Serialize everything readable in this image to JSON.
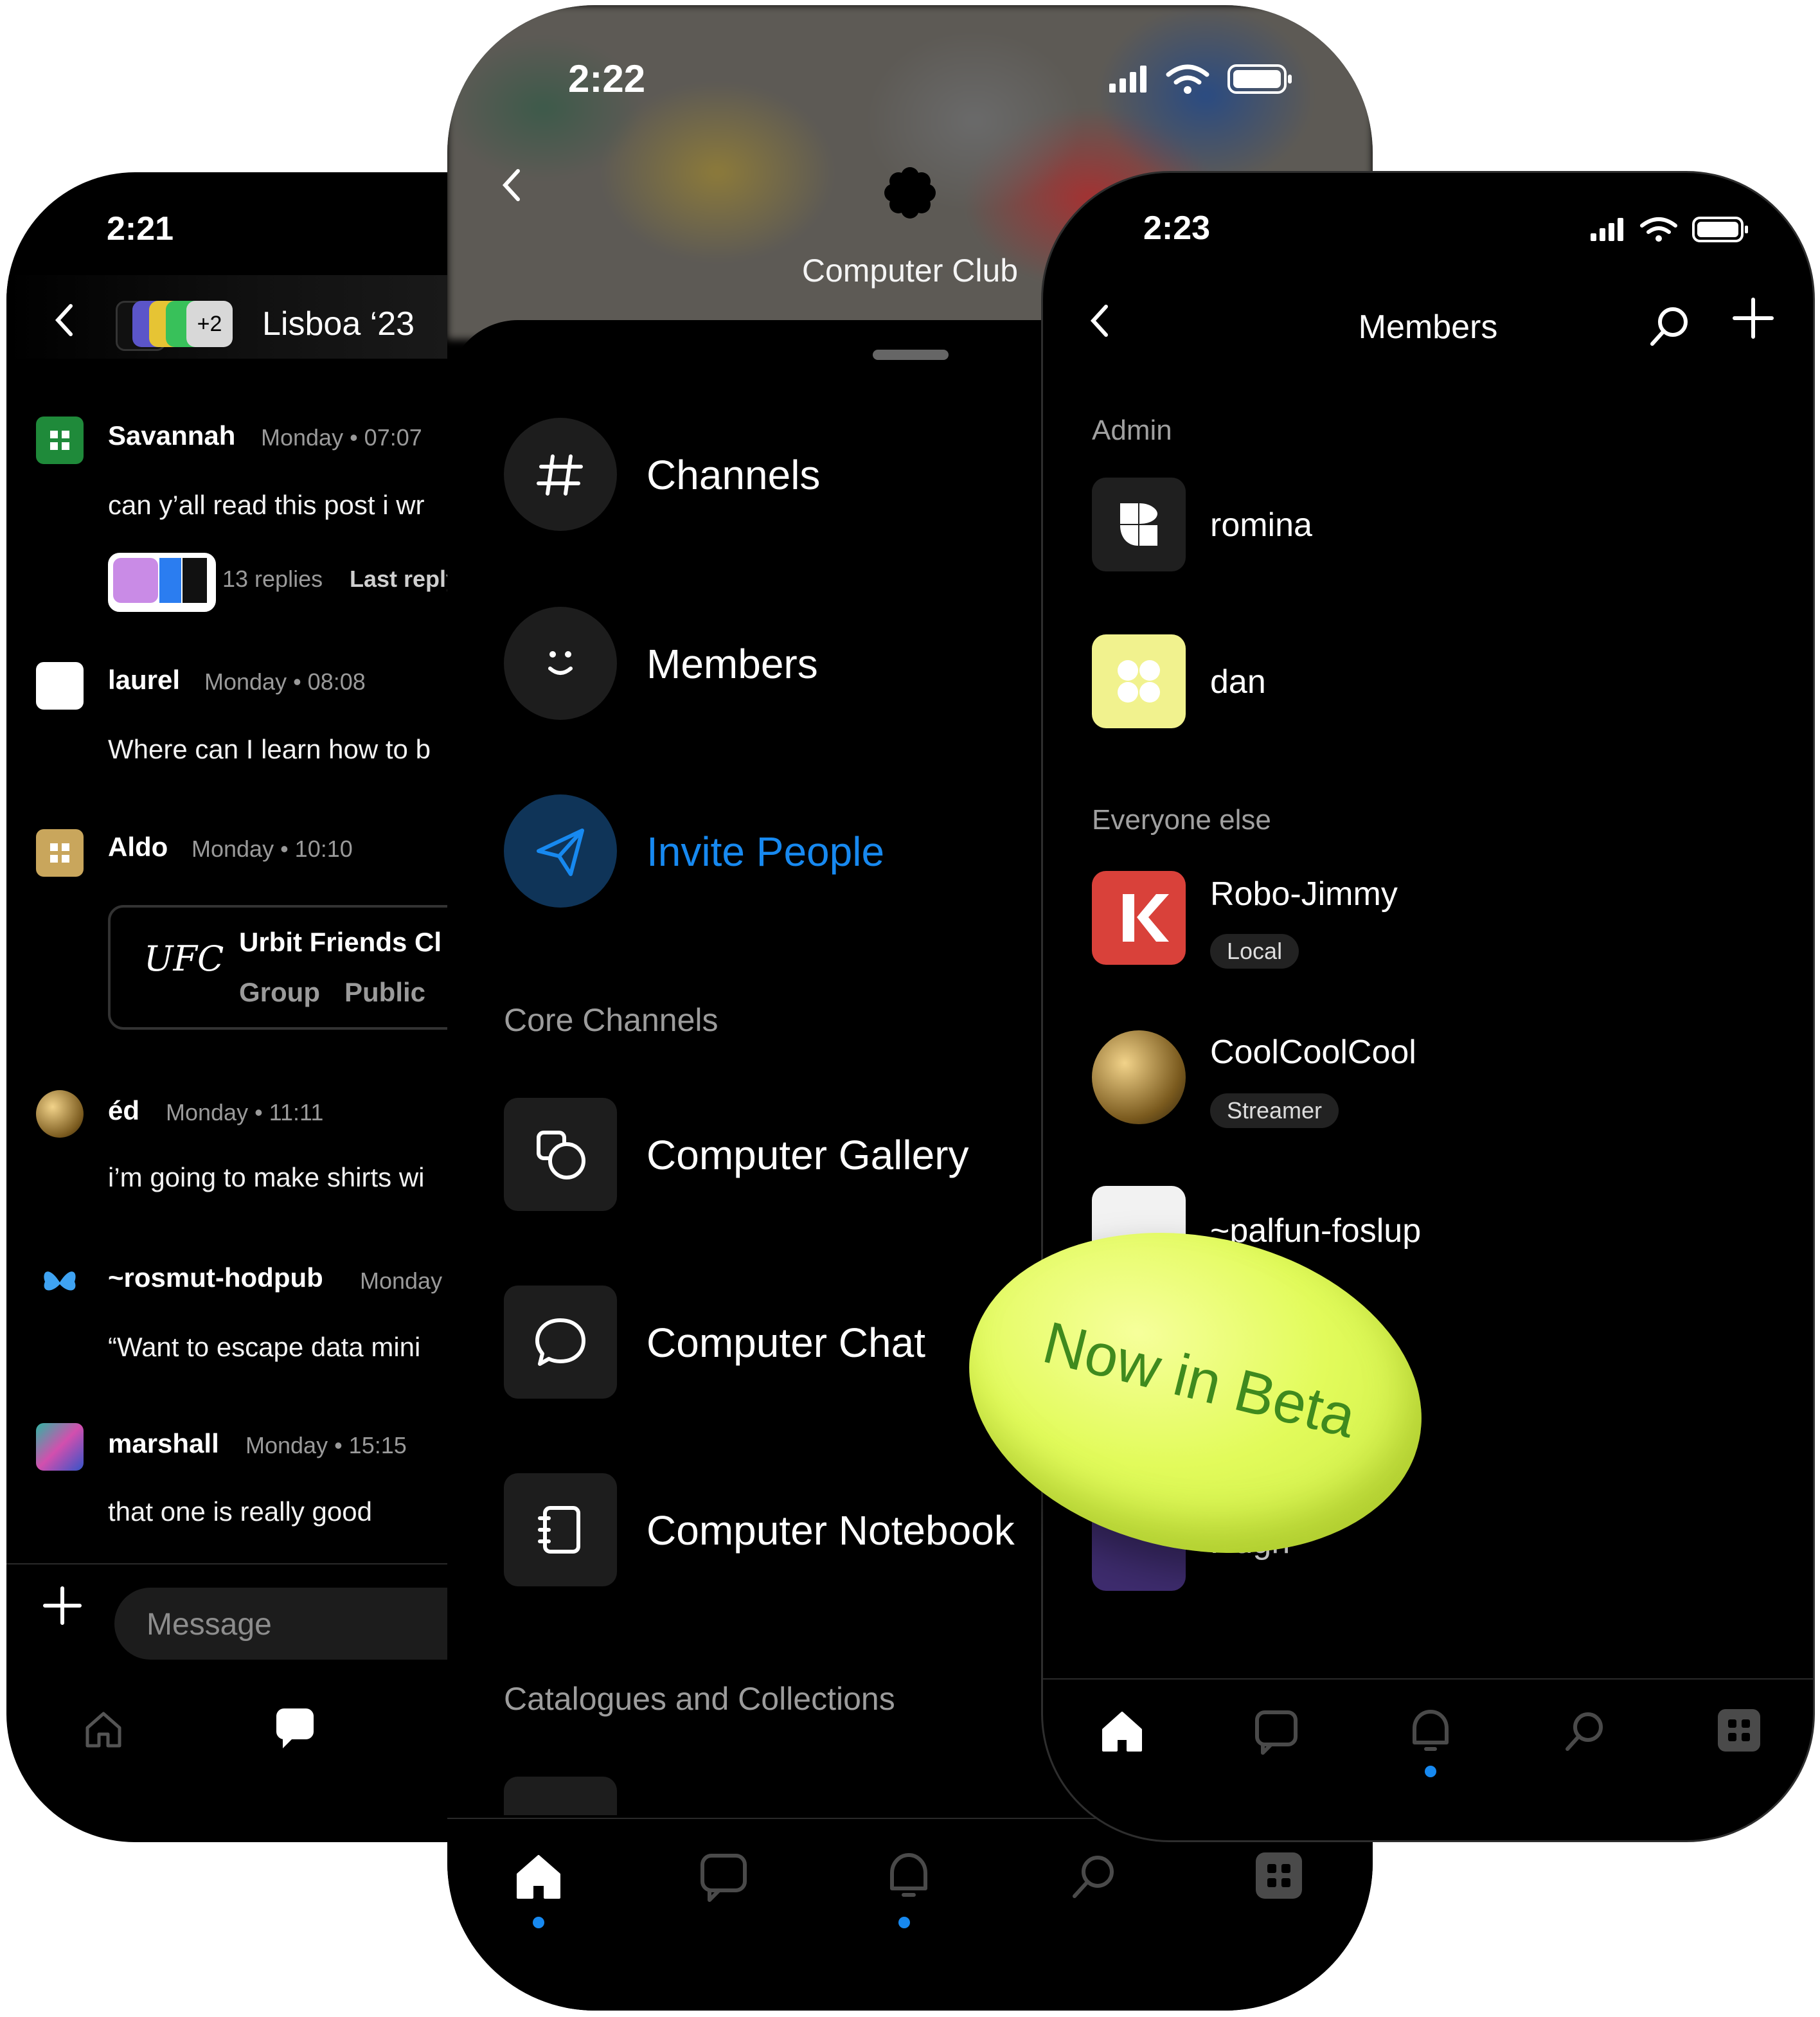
{
  "left_phone": {
    "time": "2:21",
    "chat_title": "Lisboa ‘23",
    "avatar_overflow": "+2",
    "messages": [
      {
        "name": "Savannah",
        "time": "Monday • 07:07",
        "text": "can y’all read this post i wr",
        "replies": "13 replies",
        "last_reply": "Last reply"
      },
      {
        "name": "laurel",
        "time": "Monday • 08:08",
        "text": "Where can I learn how to b"
      },
      {
        "name": "Aldo",
        "time": "Monday • 10:10",
        "card_title": "Urbit Friends Cl",
        "card_group": "Group",
        "card_public": "Public",
        "card_logo": "UFC"
      },
      {
        "name": "éd",
        "time": "Monday • 11:11",
        "text": "i’m going to make shirts wi"
      },
      {
        "name": "~rosmut-hodpub",
        "time": "Monday",
        "text": "“Want to escape data mini"
      },
      {
        "name": "marshall",
        "time": "Monday • 15:15",
        "text": "that one is really good"
      }
    ],
    "composer_placeholder": "Message",
    "icons": [
      "back-icon",
      "plus-icon",
      "home-icon",
      "chat-icon"
    ]
  },
  "middle_phone": {
    "time": "2:22",
    "group_title": "Computer Club",
    "menu": [
      {
        "label": "Channels",
        "icon": "hash-icon"
      },
      {
        "label": "Members",
        "icon": "smile-icon"
      },
      {
        "label": "Invite People",
        "icon": "send-icon"
      }
    ],
    "section_core": "Core Channels",
    "channels": [
      {
        "label": "Computer Gallery",
        "icon": "gallery-icon"
      },
      {
        "label": "Computer Chat",
        "icon": "chat-bubble-icon"
      },
      {
        "label": "Computer Notebook",
        "icon": "notebook-icon"
      }
    ],
    "section_catalogues": "Catalogues and Collections",
    "accent": "#1789f0",
    "tabs": [
      "home-icon",
      "chat-icon",
      "bell-icon",
      "search-icon",
      "apps-icon"
    ]
  },
  "right_phone": {
    "time": "2:23",
    "title": "Members",
    "section_admin": "Admin",
    "admins": [
      {
        "name": "romina"
      },
      {
        "name": "dan"
      }
    ],
    "section_everyone": "Everyone else",
    "others": [
      {
        "name": "Robo-Jimmy",
        "badge": "Local"
      },
      {
        "name": "CoolCoolCool",
        "badge": "Streamer"
      },
      {
        "name": "~palfun-foslup"
      },
      {
        "name": "Hugh"
      }
    ],
    "tabs": [
      "home-icon",
      "chat-icon",
      "bell-icon",
      "search-icon",
      "apps-icon"
    ]
  },
  "beta_badge": "Now in Beta"
}
